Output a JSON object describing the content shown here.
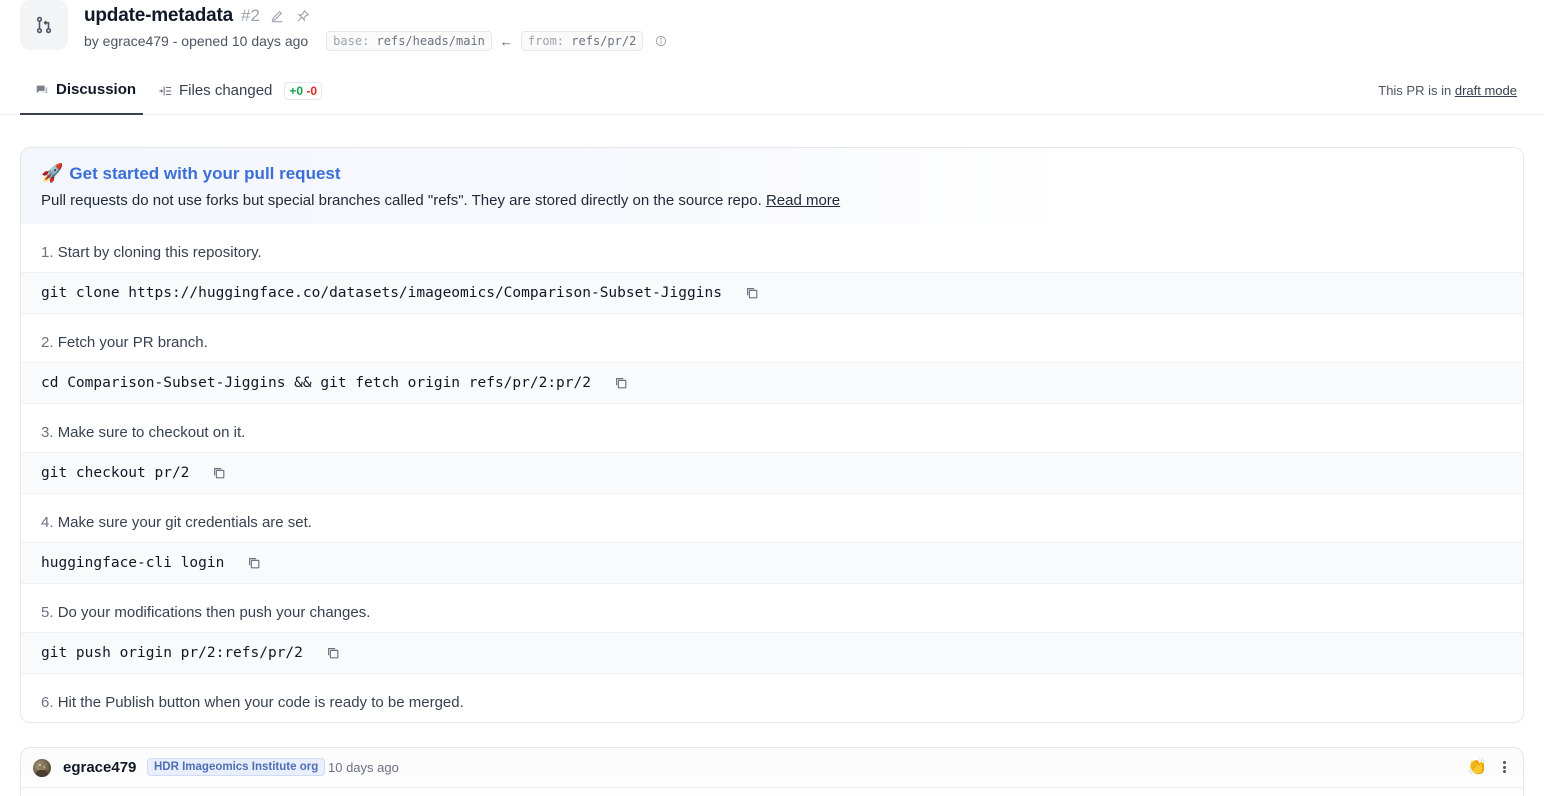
{
  "header": {
    "title": "update-metadata",
    "pr_number": "#2",
    "author_line": "by egrace479 - opened 10 days ago",
    "base_label": "base:",
    "base_ref": "refs/heads/main",
    "from_label": "from:",
    "from_ref": "refs/pr/2",
    "arrow": "←"
  },
  "tabs": [
    {
      "label": "Discussion",
      "active": true
    },
    {
      "label": "Files changed",
      "active": false,
      "additions": "+0",
      "deletions": "-0"
    }
  ],
  "draft_note": {
    "prefix": "This PR is in",
    "link": "draft mode"
  },
  "guide": {
    "rocket": "🚀",
    "title": "Get started with your pull request",
    "subtitle": "Pull requests do not use forks but special branches called \"refs\". They are stored directly on the source repo.",
    "read_more": "Read more",
    "steps": [
      {
        "num": "1.",
        "text": "Start by cloning this repository.",
        "code": "git clone https://huggingface.co/datasets/imageomics/Comparison-Subset-Jiggins"
      },
      {
        "num": "2.",
        "text": "Fetch your PR branch.",
        "code": "cd Comparison-Subset-Jiggins && git fetch origin refs/pr/2:pr/2"
      },
      {
        "num": "3.",
        "text": "Make sure to checkout on it.",
        "code": "git checkout pr/2"
      },
      {
        "num": "4.",
        "text": "Make sure your git credentials are set.",
        "code": "huggingface-cli login"
      },
      {
        "num": "5.",
        "text": "Do your modifications then push your changes.",
        "code": "git push origin pr/2:refs/pr/2"
      },
      {
        "num": "6.",
        "text": "Hit the Publish button when your code is ready to be merged.",
        "code": null
      }
    ]
  },
  "comment": {
    "username": "egrace479",
    "org_badge": "HDR Imageomics Institute org",
    "time": "10 days ago",
    "reaction": "👏"
  }
}
